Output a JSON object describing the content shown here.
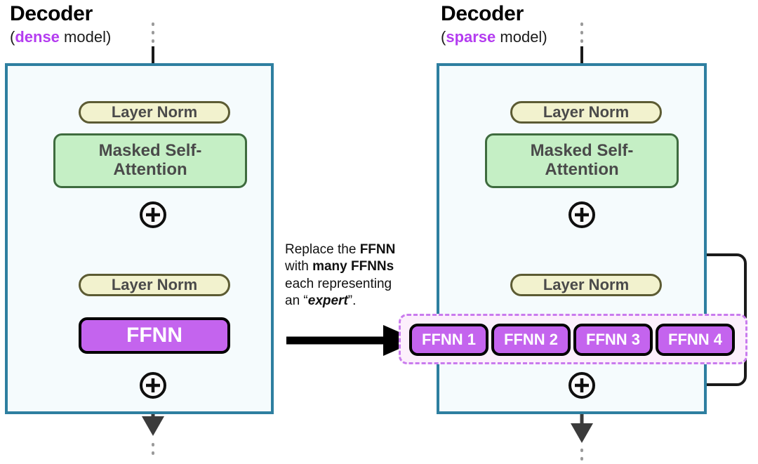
{
  "figure": {
    "type": "diagram",
    "description": "Comparison of a dense transformer decoder block and a sparse mixture-of-experts decoder block"
  },
  "left_model": {
    "title": "Decoder",
    "subtitle_open": "(",
    "subtitle_keyword": "dense",
    "subtitle_rest": " model)",
    "keyword_color": "#B43CF0",
    "frame_color": "#2E7FA0",
    "frame_fill": "#F5FBFD",
    "blocks": [
      {
        "id": "layer-norm-1",
        "label": "Layer Norm",
        "kind": "layer-norm"
      },
      {
        "id": "masked-self-attention",
        "label": "Masked Self-\nAttention",
        "line1": "Masked Self-",
        "line2": "Attention",
        "kind": "attention"
      },
      {
        "id": "add-1",
        "label": "+",
        "kind": "residual-add"
      },
      {
        "id": "layer-norm-2",
        "label": "Layer Norm",
        "kind": "layer-norm"
      },
      {
        "id": "ffnn",
        "label": "FFNN",
        "kind": "ffnn"
      },
      {
        "id": "add-2",
        "label": "+",
        "kind": "residual-add"
      }
    ]
  },
  "right_model": {
    "title": "Decoder",
    "subtitle_open": "(",
    "subtitle_keyword": "sparse",
    "subtitle_rest": " model)",
    "keyword_color": "#B43CF0",
    "frame_color": "#2E7FA0",
    "frame_fill": "#F5FBFD",
    "blocks": [
      {
        "id": "layer-norm-1",
        "label": "Layer Norm",
        "kind": "layer-norm"
      },
      {
        "id": "masked-self-attention",
        "line1": "Masked Self-",
        "line2": "Attention",
        "kind": "attention"
      },
      {
        "id": "add-1",
        "label": "+",
        "kind": "residual-add"
      },
      {
        "id": "layer-norm-2",
        "label": "Layer Norm",
        "kind": "layer-norm"
      },
      {
        "id": "add-2",
        "label": "+",
        "kind": "residual-add"
      }
    ],
    "experts": [
      {
        "id": "ffnn-1",
        "label": "FFNN 1"
      },
      {
        "id": "ffnn-2",
        "label": "FFNN 2"
      },
      {
        "id": "ffnn-3",
        "label": "FFNN 3"
      },
      {
        "id": "ffnn-4",
        "label": "FFNN 4"
      }
    ],
    "experts_container": {
      "border_style": "dashed",
      "border_color": "#C97BEE",
      "fill": "#FCEFFC"
    }
  },
  "caption": {
    "line1_a": "Replace the ",
    "line1_b": "FFNN",
    "line2_a": "with ",
    "line2_b": "many FFNNs",
    "line3": "each representing",
    "line4_a": "an “",
    "line4_b": "expert",
    "line4_c": "”."
  },
  "arrow": {
    "name": "transform-arrow",
    "direction": "right",
    "color": "#000000"
  },
  "palette": {
    "layer_norm_fill": "#F2F2CE",
    "layer_norm_border": "#5C5B33",
    "attention_fill": "#C5EFC5",
    "attention_border": "#3E6B3E",
    "ffnn_fill": "#C464EE",
    "ffnn_border": "#000000",
    "ffnn_text": "#FFFFFF",
    "node_text": "#4A4A4A",
    "wire": "#1A1A1A",
    "dotted_wire": "#9A9A9A"
  }
}
